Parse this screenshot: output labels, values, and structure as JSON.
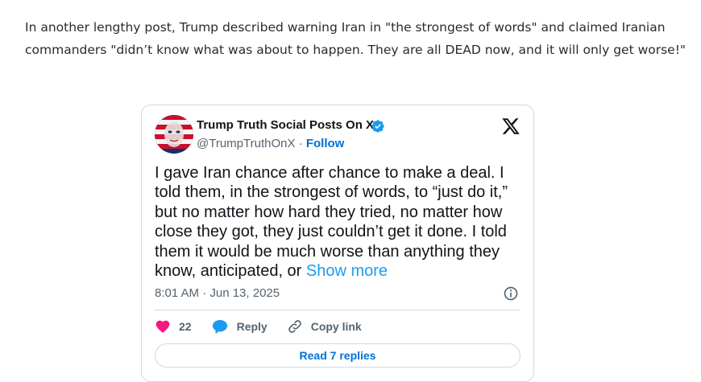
{
  "article": {
    "paragraph": "In another lengthy post, Trump described warning Iran in \"the strongest of words\" and claimed Iranian commanders \"didn’t know what was about to happen. They are all DEAD now, and it will only get worse!\""
  },
  "tweet": {
    "author_name": "Trump Truth Social Posts On X",
    "handle": "@TrumpTruthOnX",
    "separator": " · ",
    "follow_label": "Follow",
    "text": "I gave Iran chance after chance to make a deal. I told them, in the strongest of words, to “just do it,” but no matter how hard they tried, no matter how close they got, they just couldn’t get it done. I told them it would be much worse than anything they know, anticipated, or ",
    "show_more": "Show more",
    "timestamp": "8:01 AM · Jun 13, 2025",
    "like_count": "22",
    "reply_label": "Reply",
    "copy_link_label": "Copy link",
    "read_replies_label": "Read 7 replies"
  },
  "colors": {
    "link_blue": "#006fd6",
    "show_more_blue": "#1d9bf0",
    "heart_pink": "#f91880",
    "muted": "#536471",
    "border": "#cfd9de"
  },
  "icons": [
    "verified-badge-icon",
    "x-logo-icon",
    "info-icon",
    "heart-icon",
    "reply-bubble-icon",
    "link-icon"
  ]
}
